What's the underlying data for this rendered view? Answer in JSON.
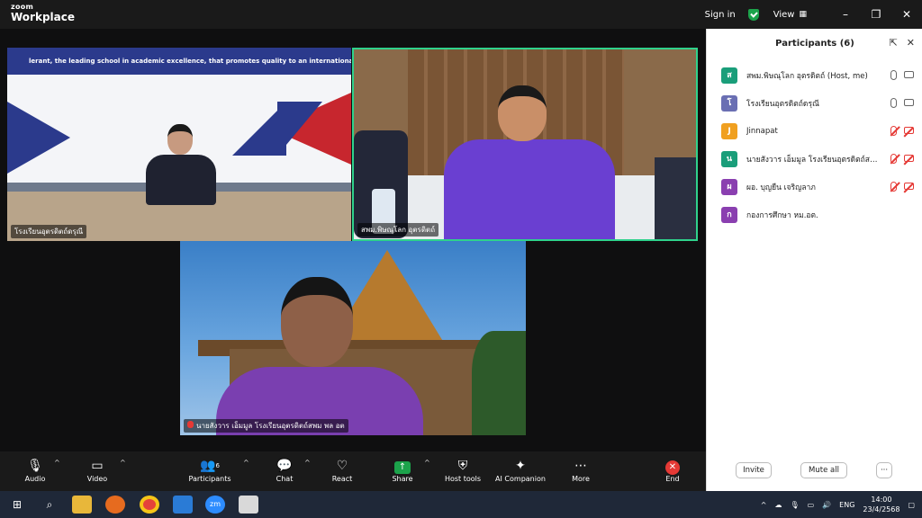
{
  "titlebar": {
    "brand_small": "zoom",
    "brand_large": "Workplace",
    "sign_in": "Sign in",
    "view": "View",
    "minimize": "–",
    "restore": "❐",
    "close": "✕"
  },
  "videos": {
    "tile1_banner": "lerant, the leading school in academic excellence, that promotes quality to an international standard, base",
    "tile1_name": "โรงเรียนอุตรดิตถ์ดรุณี",
    "tile2_name": "สพม.พิษณุโลก อุตรดิตถ์",
    "tile3_name": "นายสังวาร เอ็มมูล โรงเรียนอุตรดิตถ์สพม พล อต"
  },
  "panel": {
    "title": "Participants (6)",
    "participants": [
      {
        "initial": "ส",
        "name": "สพม.พิษณุโลก อุตรดิตถ์ (Host, me)",
        "color": "#1a9e7a",
        "muted": false
      },
      {
        "initial": "โ",
        "name": "โรงเรียนอุตรดิตถ์ดรุณี",
        "color": "#6a6fb3",
        "muted": false
      },
      {
        "initial": "J",
        "name": "Jinnapat",
        "color": "#f0a020",
        "muted": true
      },
      {
        "initial": "น",
        "name": "นายสังวาร เอ็มมูล โรงเรียนอุตรดิตถ์สพ...",
        "color": "#1a9e7a",
        "muted": true
      },
      {
        "initial": "ผ",
        "name": "ผอ. บุญยืน เจริญลาภ",
        "color": "#8a3fb0",
        "muted": true
      },
      {
        "initial": "ก",
        "name": "กองการศึกษา หม.อต.",
        "color": "#8a3fb0",
        "muted": null
      }
    ],
    "invite": "Invite",
    "mute_all": "Mute all",
    "more": "···"
  },
  "toolbar": {
    "audio": "Audio",
    "video": "Video",
    "participants": "Participants",
    "participants_count": "6",
    "chat": "Chat",
    "react": "React",
    "share": "Share",
    "host_tools": "Host tools",
    "ai_companion": "AI Companion",
    "more": "More",
    "end": "End"
  },
  "taskbar": {
    "lang": "ENG",
    "time": "14:00",
    "date": "23/4/2568"
  }
}
